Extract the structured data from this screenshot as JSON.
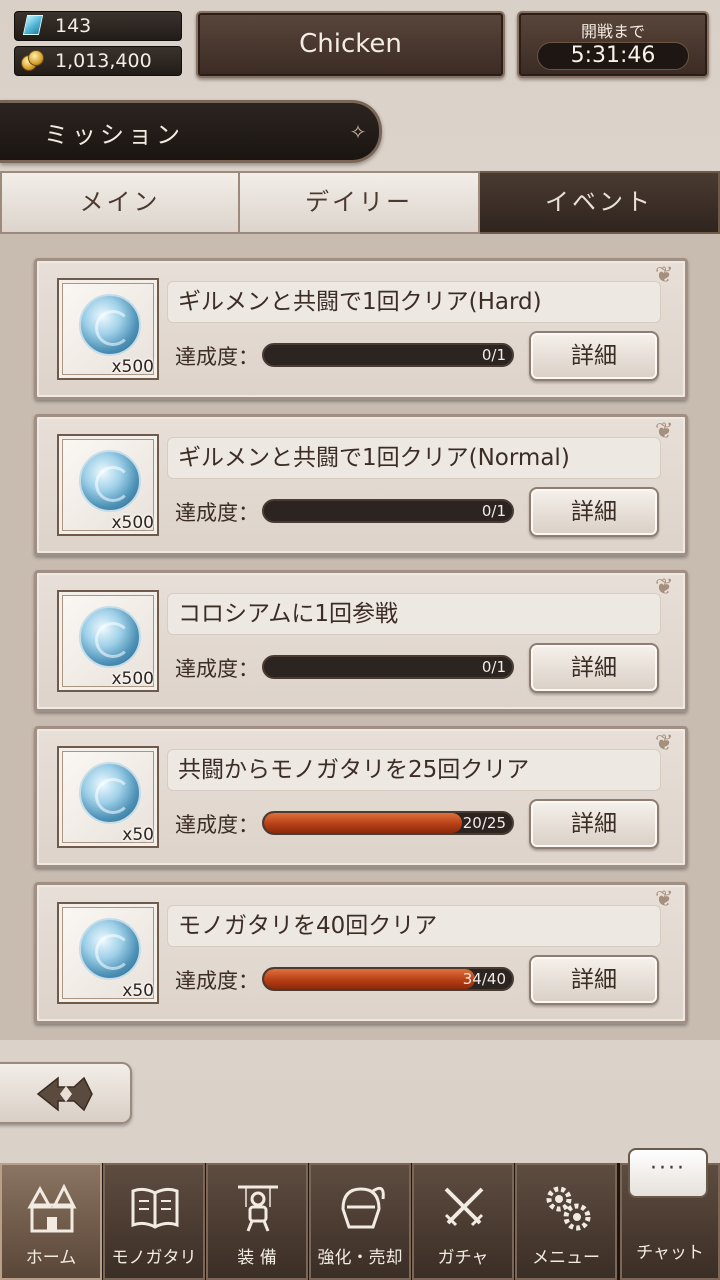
{
  "status": {
    "gems": "143",
    "coins": "1,013,400",
    "player_name": "Chicken",
    "timer_label": "開戦まで",
    "timer_value": "5:31:46"
  },
  "header": {
    "title": "ミッション"
  },
  "tabs": [
    {
      "label": "メイン",
      "active": false
    },
    {
      "label": "デイリー",
      "active": false
    },
    {
      "label": "イベント",
      "active": true
    }
  ],
  "progress_label": "達成度：",
  "detail_label": "詳細",
  "missions": [
    {
      "title": "ギルメンと共闘で1回クリア(Hard)",
      "reward_qty": "x500",
      "progress_text": "0/1",
      "progress": 0.0
    },
    {
      "title": "ギルメンと共闘で1回クリア(Normal)",
      "reward_qty": "x500",
      "progress_text": "0/1",
      "progress": 0.0
    },
    {
      "title": "コロシアムに1回参戦",
      "reward_qty": "x500",
      "progress_text": "0/1",
      "progress": 0.0
    },
    {
      "title": "共闘からモノガタリを25回クリア",
      "reward_qty": "x50",
      "progress_text": "20/25",
      "progress": 0.8
    },
    {
      "title": "モノガタリを40回クリア",
      "reward_qty": "x50",
      "progress_text": "34/40",
      "progress": 0.85
    }
  ],
  "nav": [
    {
      "label": "ホーム",
      "icon": "castle-icon",
      "active": true
    },
    {
      "label": "モノガタリ",
      "icon": "book-icon",
      "active": false
    },
    {
      "label": "装 備",
      "icon": "puppet-icon",
      "active": false
    },
    {
      "label": "強化・売却",
      "icon": "helmet-icon",
      "active": false
    },
    {
      "label": "ガチャ",
      "icon": "crossed-swords-icon",
      "active": false
    },
    {
      "label": "メニュー",
      "icon": "gears-icon",
      "active": false
    }
  ],
  "chat": {
    "label": "チャット",
    "bubble": "····"
  },
  "colors": {
    "progress_fill": "#b43c14",
    "active_tab": "#2f241e"
  }
}
